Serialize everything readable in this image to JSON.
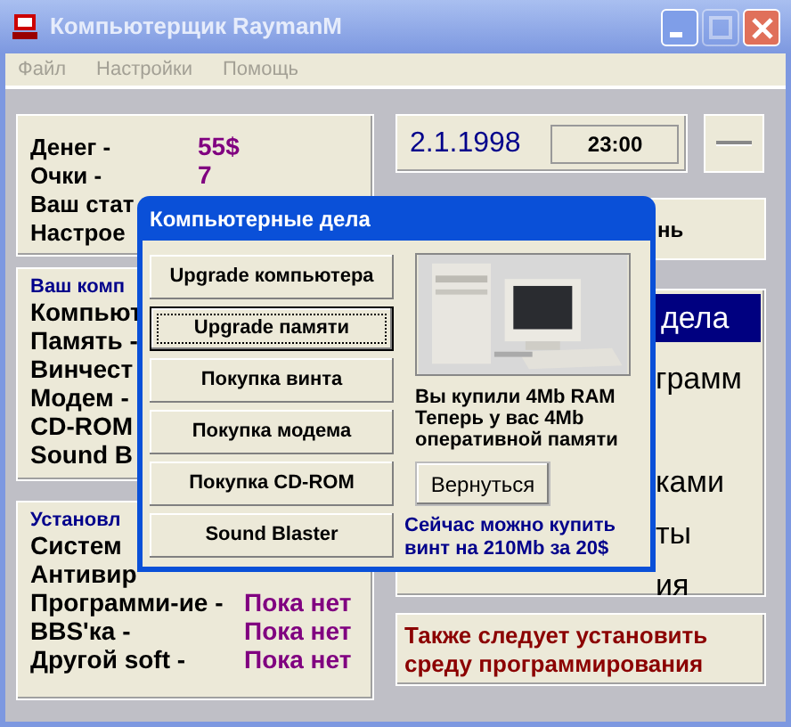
{
  "window": {
    "title": "Компьютерщик RaymanM",
    "controls": [
      {
        "kind": "minimize",
        "disabled": false
      },
      {
        "kind": "maximize",
        "disabled": true
      },
      {
        "kind": "close",
        "disabled": false
      }
    ]
  },
  "menu": [
    "Файл",
    "Настройки",
    "Помощь"
  ],
  "stats": [
    {
      "label": "Денег -",
      "value": "55$"
    },
    {
      "label": "Очки -",
      "value": "7"
    },
    {
      "label": "Ваш стат"
    },
    {
      "label": "Настрое"
    }
  ],
  "date": "2.1.1998",
  "time": "23:00",
  "computer": {
    "title": "Ваш комп",
    "items": [
      "Компьют",
      "Память -",
      "Винчест",
      "Модем -",
      "CD-ROM",
      "Sound B"
    ]
  },
  "installed": {
    "title": "Установл",
    "items": [
      {
        "label": "Систем"
      },
      {
        "label": "Антивир"
      },
      {
        "label": "Программи-ие -",
        "value": "Пока нет"
      },
      {
        "label": "BBS'ка -",
        "value": "Пока нет"
      },
      {
        "label": "Другой soft -",
        "value": "Пока нет"
      }
    ]
  },
  "next_day_button": "нь",
  "tasks": {
    "title": "дела",
    "items": [
      "грамм",
      "ками",
      "ты",
      "ия"
    ]
  },
  "hint": "Также следует установить среду программирования",
  "dialog": {
    "title": "Компьютерные дела",
    "buttons": [
      {
        "label": "Upgrade компьютера",
        "focused": false
      },
      {
        "label": "Upgrade памяти",
        "focused": true
      },
      {
        "label": "Покупка винта",
        "focused": false
      },
      {
        "label": "Покупка модема",
        "focused": false
      },
      {
        "label": "Покупка CD-ROM",
        "focused": false
      },
      {
        "label": "Sound Blaster",
        "focused": false
      }
    ],
    "message": "Вы купили 4Mb RAM Теперь у вас 4Mb оперативной памяти",
    "back_button": "Вернуться",
    "offer": "Сейчас можно купить винт на 210Mb за 20$"
  }
}
